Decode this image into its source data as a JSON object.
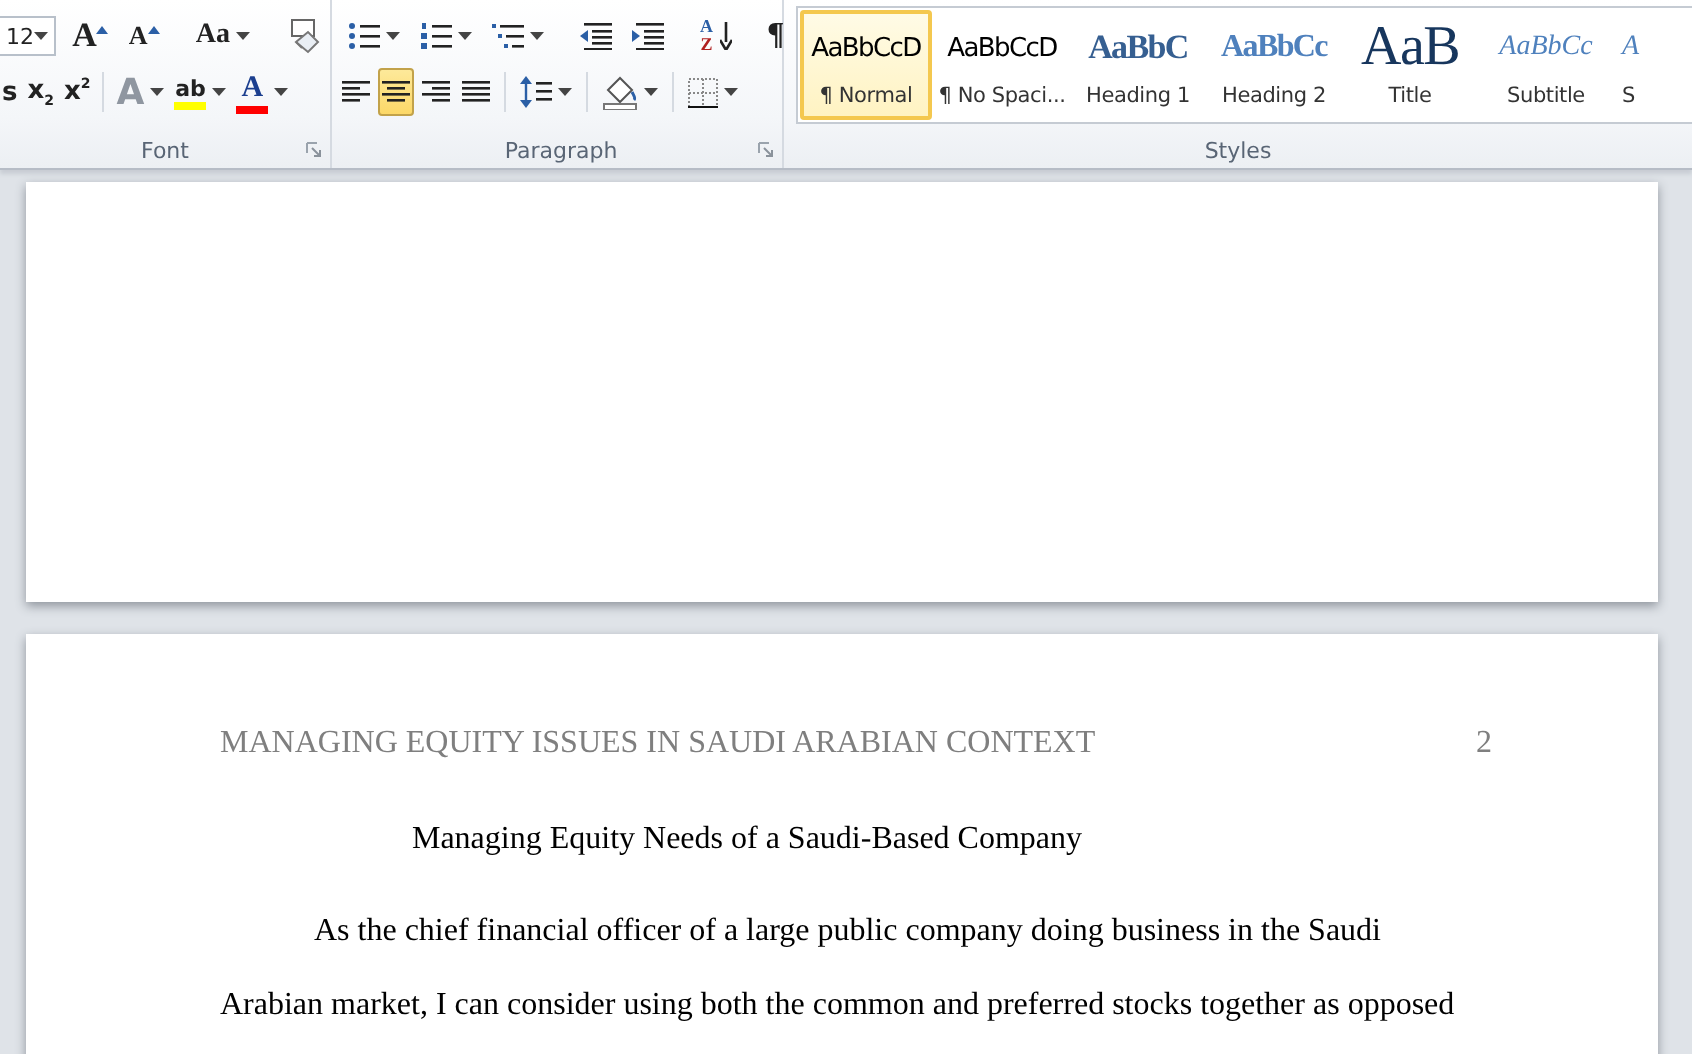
{
  "ribbon": {
    "font": {
      "label": "Font",
      "size_field": {
        "value": "12"
      },
      "row1": [
        {
          "kind": "grow-font",
          "glyph": "A",
          "dropdown": false
        },
        {
          "kind": "shrink-font",
          "glyph": "A",
          "dropdown": false
        },
        {
          "kind": "change-case",
          "glyph": "Aa",
          "dropdown": true
        },
        {
          "kind": "clear-format",
          "dropdown": false
        }
      ],
      "row2": [
        {
          "kind": "partial",
          "glyph": "s",
          "disabled": false,
          "dropdown": false
        },
        {
          "kind": "subscript",
          "glyph": "x$_{2}$",
          "disabled": false,
          "dropdown": false
        },
        {
          "kind": "superscript",
          "glyph": "x$^{2}$",
          "disabled": false,
          "dropdown": false
        },
        {
          "kind": "text-effects",
          "glyph": "A",
          "disabled": true,
          "dropdown": true
        },
        {
          "kind": "highlight",
          "glyph": "ab",
          "color": "#ffff00",
          "disabled": false,
          "dropdown": true
        },
        {
          "kind": "font-color",
          "glyph": "A",
          "color": "#ff0000",
          "disabled": false,
          "dropdown": true
        }
      ]
    },
    "paragraph": {
      "label": "Paragraph",
      "row1": [
        {
          "kind": "bullets",
          "dropdown": true
        },
        {
          "kind": "numbering",
          "dropdown": true
        },
        {
          "kind": "multilevel",
          "dropdown": true
        },
        {
          "kind": "decrease-indent",
          "dropdown": false
        },
        {
          "kind": "increase-indent",
          "dropdown": false
        },
        {
          "kind": "sort",
          "glyph_top": "A",
          "glyph_bottom": "Z",
          "dropdown": false
        },
        {
          "kind": "pilcrow",
          "glyph": "¶",
          "dropdown": false
        }
      ],
      "alignment": [
        {
          "kind": "left",
          "selected": false
        },
        {
          "kind": "center",
          "selected": true
        },
        {
          "kind": "right",
          "selected": false
        },
        {
          "kind": "justify",
          "selected": false
        }
      ],
      "row2": [
        {
          "kind": "line-spacing",
          "dropdown": true
        },
        {
          "kind": "shading",
          "dropdown": true
        },
        {
          "kind": "borders",
          "dropdown": true
        }
      ]
    },
    "styles": {
      "label": "Styles",
      "items": [
        {
          "kind": "normal",
          "preview": "AaBbCcD",
          "label": "¶ Normal",
          "selected": true
        },
        {
          "kind": "normal",
          "preview": "AaBbCcD",
          "label": "¶ No Spaci...",
          "selected": false
        },
        {
          "kind": "heading1",
          "preview": "AaBbC",
          "label": "Heading 1",
          "selected": false
        },
        {
          "kind": "heading2",
          "preview": "AaBbCc",
          "label": "Heading 2",
          "selected": false
        },
        {
          "kind": "title",
          "preview": "AaB",
          "label": "Title",
          "selected": false
        },
        {
          "kind": "subtitle",
          "preview": "AaBbCc",
          "label": "Subtitle",
          "selected": false
        },
        {
          "kind": "partial",
          "preview": "A",
          "label": "S",
          "selected": false
        }
      ]
    }
  },
  "document": {
    "header": "MANAGING EQUITY ISSUES IN SAUDI ARABIAN CONTEXT",
    "page_number": "2",
    "title": "Managing Equity Needs of a Saudi-Based Company",
    "lines": [
      {
        "kind": "first",
        "text": "As the chief financial officer of a large public company doing business in the Saudi"
      },
      {
        "kind": "body",
        "text": "Arabian market, I can consider using both the common and preferred stocks together as opposed"
      }
    ]
  }
}
